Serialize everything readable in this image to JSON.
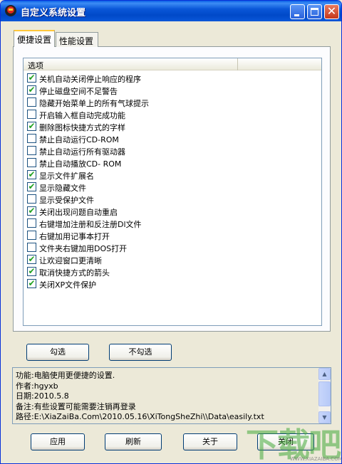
{
  "window": {
    "title": "自定义系统设置"
  },
  "tabs": [
    {
      "label": "便捷设置",
      "active": true
    },
    {
      "label": "性能设置",
      "active": false
    }
  ],
  "list": {
    "column_header": "选项",
    "items": [
      {
        "label": "关机自动关闭停止响应的程序",
        "checked": true
      },
      {
        "label": "停止磁盘空间不足警告",
        "checked": true
      },
      {
        "label": "隐藏开始菜单上的所有气球提示",
        "checked": false
      },
      {
        "label": "开启输入框自动完成功能",
        "checked": false
      },
      {
        "label": "删除图标快捷方式的字样",
        "checked": true
      },
      {
        "label": "禁止自动运行CD-ROM",
        "checked": false
      },
      {
        "label": "禁止自动运行所有驱动器",
        "checked": false
      },
      {
        "label": "禁止自动播放CD- ROM",
        "checked": false
      },
      {
        "label": "显示文件扩展名",
        "checked": true
      },
      {
        "label": "显示隐藏文件",
        "checked": true
      },
      {
        "label": "显示受保护文件",
        "checked": false
      },
      {
        "label": "关闭出现问题自动重启",
        "checked": true
      },
      {
        "label": "右键增加注册和反注册Dl文件",
        "checked": false
      },
      {
        "label": "右键加用记事本打开",
        "checked": false
      },
      {
        "label": "文件夹右键加用DOS打开",
        "checked": false
      },
      {
        "label": "让欢迎窗口更清晰",
        "checked": true
      },
      {
        "label": "取消快捷方式的箭头",
        "checked": true
      },
      {
        "label": "关闭XP文件保护",
        "checked": true
      }
    ]
  },
  "buttons": {
    "check_all": "勾选",
    "uncheck_all": "不勾选",
    "apply": "应用",
    "refresh": "刷新",
    "about": "关于",
    "close": "关闭"
  },
  "info": {
    "lines": [
      "功能:电脑使用更便捷的设置.",
      "作者:hgyxb",
      "日期:2010.5.8",
      "备注:有些设置可能需要注销再登录",
      "路径:E:\\XiaZaiBa.Com\\2010.05.16\\XiTongSheZhi\\\\Data\\easily.txt"
    ]
  },
  "watermark": {
    "text": "下载吧",
    "sub": "WWW.XIAZAIBA.COM"
  },
  "colors": {
    "titlebar": "#0a57d8",
    "check_tick": "#21a121",
    "window_bg": "#ece9d8"
  },
  "icons": {
    "app": "app-logo-icon",
    "minimize": "minimize-icon",
    "maximize": "maximize-icon",
    "close": "close-icon",
    "scroll_up": "scroll-up-arrow-icon",
    "scroll_down": "scroll-down-arrow-icon"
  }
}
